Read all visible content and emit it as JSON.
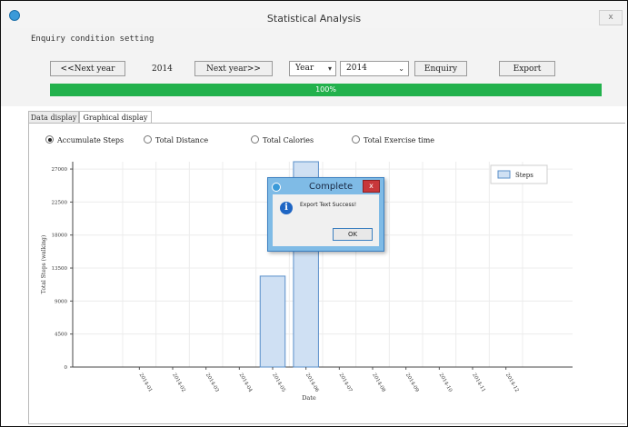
{
  "window": {
    "title": "Statistical Analysis",
    "close_label": "x"
  },
  "query": {
    "section_label": "Enquiry condition setting",
    "prev_year_label": "<<Next year",
    "year_value": "2014",
    "next_year_label": "Next year>>",
    "period_select": "Year",
    "year_select": "2014",
    "enquiry_label": "Enquiry",
    "export_label": "Export"
  },
  "progress": {
    "value": 1.0,
    "text": "100%",
    "color": "#22b14c"
  },
  "tabs": [
    {
      "label": "Data display",
      "active": false
    },
    {
      "label": "Graphical display",
      "active": true
    }
  ],
  "metrics": [
    {
      "label": "Accumulate Steps",
      "selected": true
    },
    {
      "label": "Total Distance",
      "selected": false
    },
    {
      "label": "Total Calories",
      "selected": false
    },
    {
      "label": "Total Exercise time",
      "selected": false
    }
  ],
  "chart_data": {
    "type": "bar",
    "categories": [
      "2014-01",
      "2014-02",
      "2014-03",
      "2014-04",
      "2014-05",
      "2014-06",
      "2014-07",
      "2014-08",
      "2014-09",
      "2014-10",
      "2014-11",
      "2014-12"
    ],
    "series": [
      {
        "name": "Steps",
        "values": [
          0,
          0,
          0,
          0,
          12400,
          28000,
          0,
          0,
          0,
          0,
          0,
          0
        ]
      }
    ],
    "ylabel": "Total Steps (walking)",
    "xlabel": "Date",
    "yticks": [
      0,
      4500,
      9000,
      13500,
      18000,
      22500,
      27000
    ],
    "ytick_labels": [
      "0",
      "4500",
      "9000",
      "13500",
      "18000",
      "22500",
      "27000"
    ],
    "ylim": [
      0,
      28000
    ],
    "grid": true,
    "legend": "top-right",
    "bar_color": "#cfe0f3",
    "bar_border": "#5a8fc9"
  },
  "dialog": {
    "title": "Complete",
    "message": "Export Text Success!",
    "ok_label": "OK",
    "close_label": "x"
  }
}
